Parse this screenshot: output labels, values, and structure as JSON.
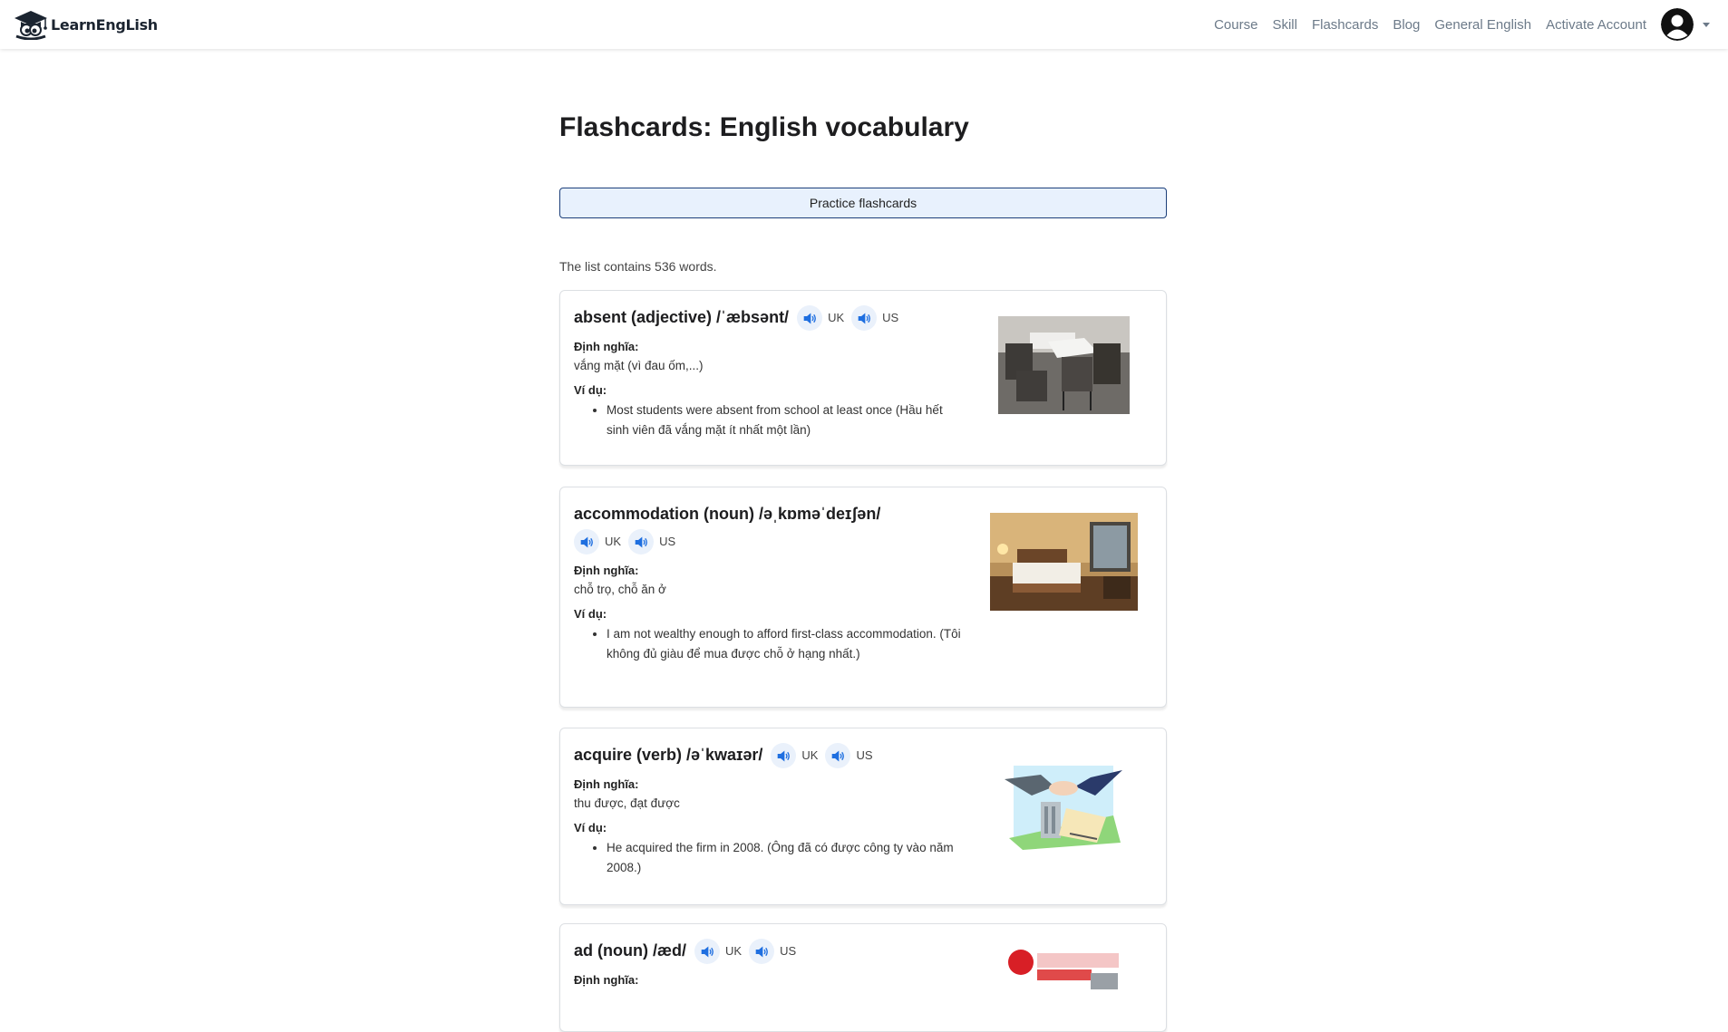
{
  "brand": {
    "name": "LearnEngLish"
  },
  "nav": {
    "links": [
      "Course",
      "Skill",
      "Flashcards",
      "Blog",
      "General English",
      "Activate Account"
    ]
  },
  "page": {
    "title": "Flashcards: English vocabulary",
    "practice_label": "Practice flashcards",
    "count_text": "The list contains 536 words."
  },
  "labels": {
    "uk": "UK",
    "us": "US",
    "definition": "Định nghĩa:",
    "example": "Ví dụ:"
  },
  "words": [
    {
      "headword": "absent (adjective) /ˈæbsənt/",
      "definition": "vắng mặt (vì đau ốm,...)",
      "example": "Most students were absent from school at least once (Hầu hết sinh viên đã vắng mặt ít nhất một lần)",
      "image": "classroom-photo"
    },
    {
      "headword": "accommodation (noun) /əˌkɒməˈdeɪʃən/",
      "definition": "chỗ trọ, chỗ ăn ở",
      "example": "I am not wealthy enough to afford first-class accommodation. (Tôi không đủ giàu để mua được chỗ ở hạng nhất.)",
      "image": "hotel-room-photo"
    },
    {
      "headword": "acquire (verb) /əˈkwaɪər/",
      "definition": "thu được, đạt được",
      "example": "He acquired the firm in 2008. (Ông đã có được công ty vào năm 2008.)",
      "image": "handshake-illustration"
    },
    {
      "headword": "ad (noun) /æd/",
      "definition": "",
      "example": "",
      "image": "advertisement-image"
    }
  ],
  "colors": {
    "nav_link": "#6c7a89",
    "speaker": "#1f6fe0",
    "practice_bg": "#e8f1fd",
    "practice_border": "#1c3f7a"
  }
}
